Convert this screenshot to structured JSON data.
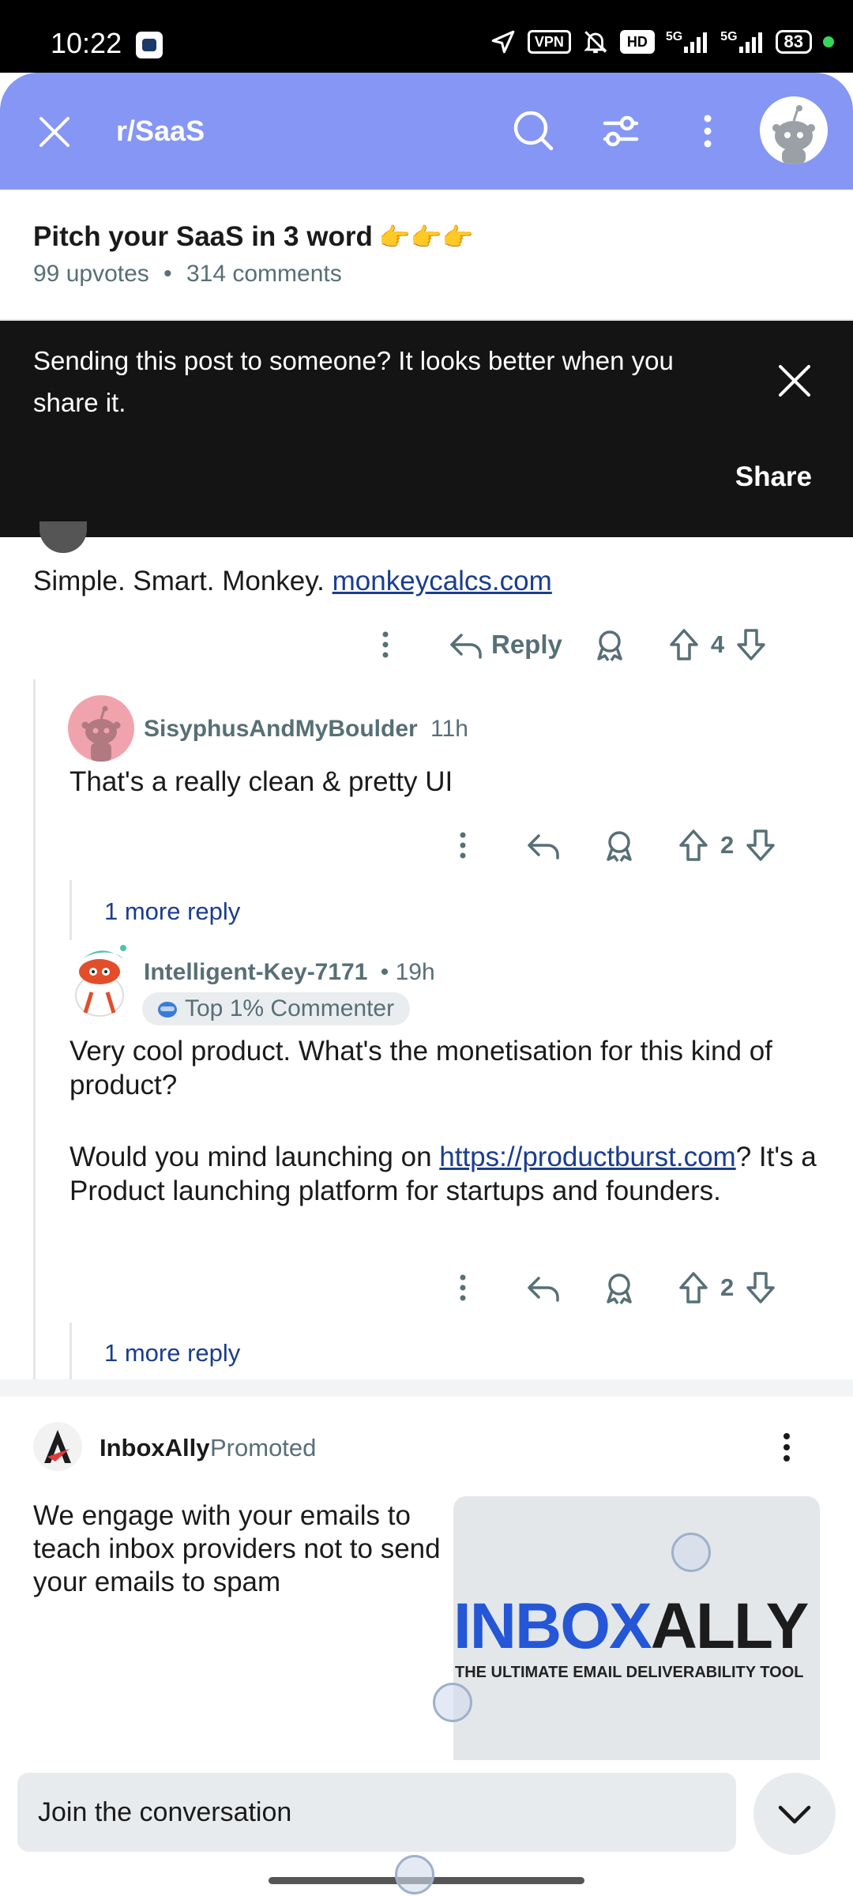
{
  "status_bar": {
    "time": "10:22",
    "vpn": "VPN",
    "hd": "HD",
    "net1": "5G",
    "net2": "5G",
    "battery": "83"
  },
  "header": {
    "subreddit": "r/SaaS"
  },
  "post": {
    "title": "Pitch your SaaS in 3 word",
    "title_emoji": "👉👉👉",
    "upvotes": "99 upvotes",
    "separator": "•",
    "comments": "314 comments"
  },
  "toast": {
    "message": "Sending this post to someone? It looks better when you share it.",
    "action": "Share"
  },
  "comments": [
    {
      "text_prefix": "Simple. Smart. Monkey. ",
      "link": "monkeycalcs.com",
      "reply_label": "Reply",
      "votes": "4"
    },
    {
      "user": "SisyphusAndMyBoulder",
      "time": "11h",
      "text": "That's a really clean & pretty UI",
      "votes": "2",
      "more": "1 more reply"
    },
    {
      "user": "Intelligent-Key-7171",
      "time": "• 19h",
      "badge": "Top 1% Commenter",
      "text_p1": "Very cool product. What's the monetisation for this kind of product?",
      "text_p2_prefix": "Would you mind launching on ",
      "text_p2_link": "https://productburst.com",
      "text_p2_suffix": "? It's a Product launching platform for startups and founders.",
      "votes": "2",
      "more": "1 more reply"
    }
  ],
  "promoted": {
    "name": "InboxAlly",
    "tag": "Promoted",
    "text": "We engage with your emails to teach inbox providers not to send your emails to spam",
    "brand_blue": "INBOX",
    "brand_dark": "ALLY",
    "brand_tagline": "THE ULTIMATE EMAIL DELIVERABILITY TOOL"
  },
  "bottom": {
    "placeholder": "Join the conversation"
  },
  "colors": {
    "header": "#8596f4",
    "toast": "#141414",
    "link": "#1a3d8f",
    "meta": "#576f76"
  }
}
